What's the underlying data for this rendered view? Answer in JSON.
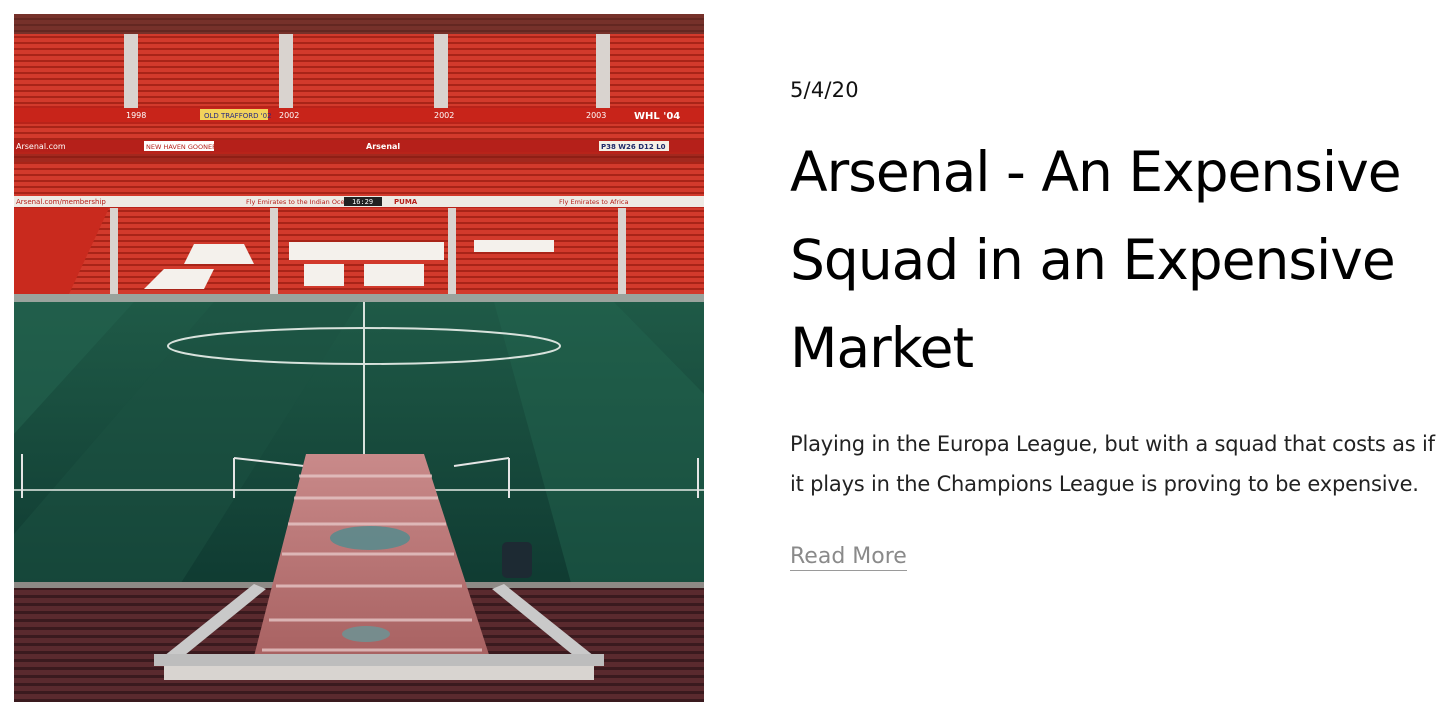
{
  "post": {
    "date": "5/4/20",
    "title": "Arsenal - An Expensive Squad in an Expensive Market",
    "excerpt": "Playing in the Europa League, but with a squad that costs as if it plays in the Champions League is proving to be expensive.",
    "read_more_label": "Read More"
  },
  "image": {
    "alt": "Arsenal stadium stands and pitch",
    "signage": {
      "row1_left": "1998",
      "row1_mid": "OLD TRAFFORD '02",
      "row1_b": "2002",
      "row1_c": "2002",
      "row1_d": "2003",
      "row1_e": "WHL '04",
      "row2_a": "Arsenal.com",
      "row2_b": "NEW HAVEN GOONERS",
      "row2_c": "Arsenal",
      "row2_d": "P38 W26 D12 L0",
      "row3_a": "Arsenal.com/membership",
      "row3_b": "Fly Emirates to the Indian Ocean",
      "row3_c": "16:29",
      "row3_d": "PUMA",
      "row3_e": "Fly Emirates to Africa"
    }
  }
}
